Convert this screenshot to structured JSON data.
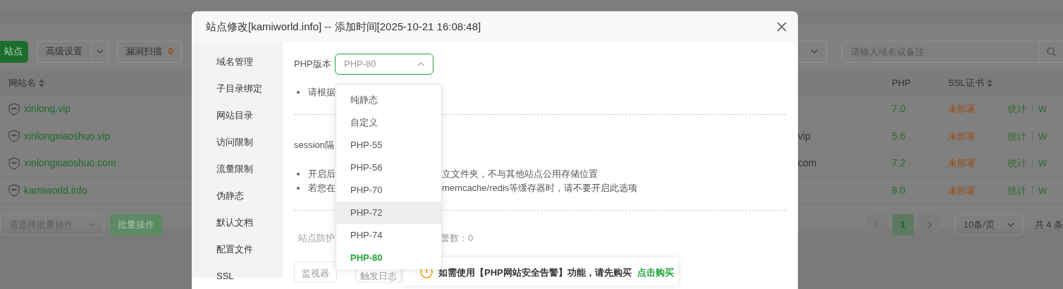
{
  "background": {
    "toolbar": {
      "add_button": "站点",
      "advanced_button": "高级设置",
      "scan_button": {
        "label": "漏洞扫描",
        "count": "0"
      }
    },
    "search": {
      "placeholder": "请输入域名或备注"
    },
    "table": {
      "columns": [
        "网站名",
        "PHP",
        "SSL证书"
      ],
      "rows": [
        {
          "name": "xinlong.vip",
          "php": "7.0",
          "ssl": "未部署",
          "actions": [
            "统计",
            "W"
          ]
        },
        {
          "name": "xinlongxiaoshuo.vip",
          "column_3": "vip",
          "php": "5.6",
          "ssl": "未部署",
          "actions": [
            "统计",
            "W"
          ]
        },
        {
          "name": "xinlongxiaoshuo.com",
          "column_3": "com",
          "php": "7.2",
          "ssl": "未部署",
          "actions": [
            "统计",
            "W"
          ]
        },
        {
          "name": "kamiworld.info",
          "php": "8.0",
          "ssl": "未部署",
          "actions": [
            "统计",
            "W"
          ]
        }
      ]
    },
    "footer": {
      "batch_select": {
        "placeholder": "请选择批量操作"
      },
      "batch_button": "批量操作",
      "pages": [
        {
          "label": "1",
          "selected": true
        }
      ],
      "page_size": "10条/页",
      "total": "共 4 条"
    }
  },
  "dialog": {
    "title": "站点修改[kamiworld.info] -- 添加时间[2025-10-21 16:08:48]",
    "menu": [
      "域名管理",
      "子目录绑定",
      "网站目录",
      "访问限制",
      "流量限制",
      "伪静态",
      "默认文档",
      "配置文件",
      "SSL"
    ],
    "php_version": {
      "label": "PHP版本",
      "value": "PHP-80",
      "open": true,
      "options": [
        {
          "label": "纯静态",
          "selected": false,
          "highlighted": false
        },
        {
          "label": "自定义",
          "selected": false,
          "highlighted": false
        },
        {
          "label": "PHP-55",
          "selected": false,
          "highlighted": false
        },
        {
          "label": "PHP-56",
          "selected": false,
          "highlighted": false
        },
        {
          "label": "PHP-70",
          "selected": false,
          "highlighted": false
        },
        {
          "label": "PHP-72",
          "selected": false,
          "highlighted": true
        },
        {
          "label": "PHP-74",
          "selected": false,
          "highlighted": false
        },
        {
          "label": "PHP-80",
          "selected": true,
          "highlighted": false
        }
      ]
    },
    "php_note": "请根据",
    "session_label": "session隔",
    "session_notes": [
      {
        "left": "开启后",
        "right": "立文件夹，不与其他站点公用存储位置"
      },
      {
        "left": "若您在",
        "right": "memcache/redis等缓存器时，请不要开启此选项"
      }
    ],
    "protection": {
      "label": "站点防护",
      "count": "警数：0"
    },
    "buttons": [
      "监视器",
      "触发日志"
    ],
    "notice": {
      "text": "如需使用【PHP网站安全告警】功能，请先购买",
      "link": "点击购买"
    }
  }
}
